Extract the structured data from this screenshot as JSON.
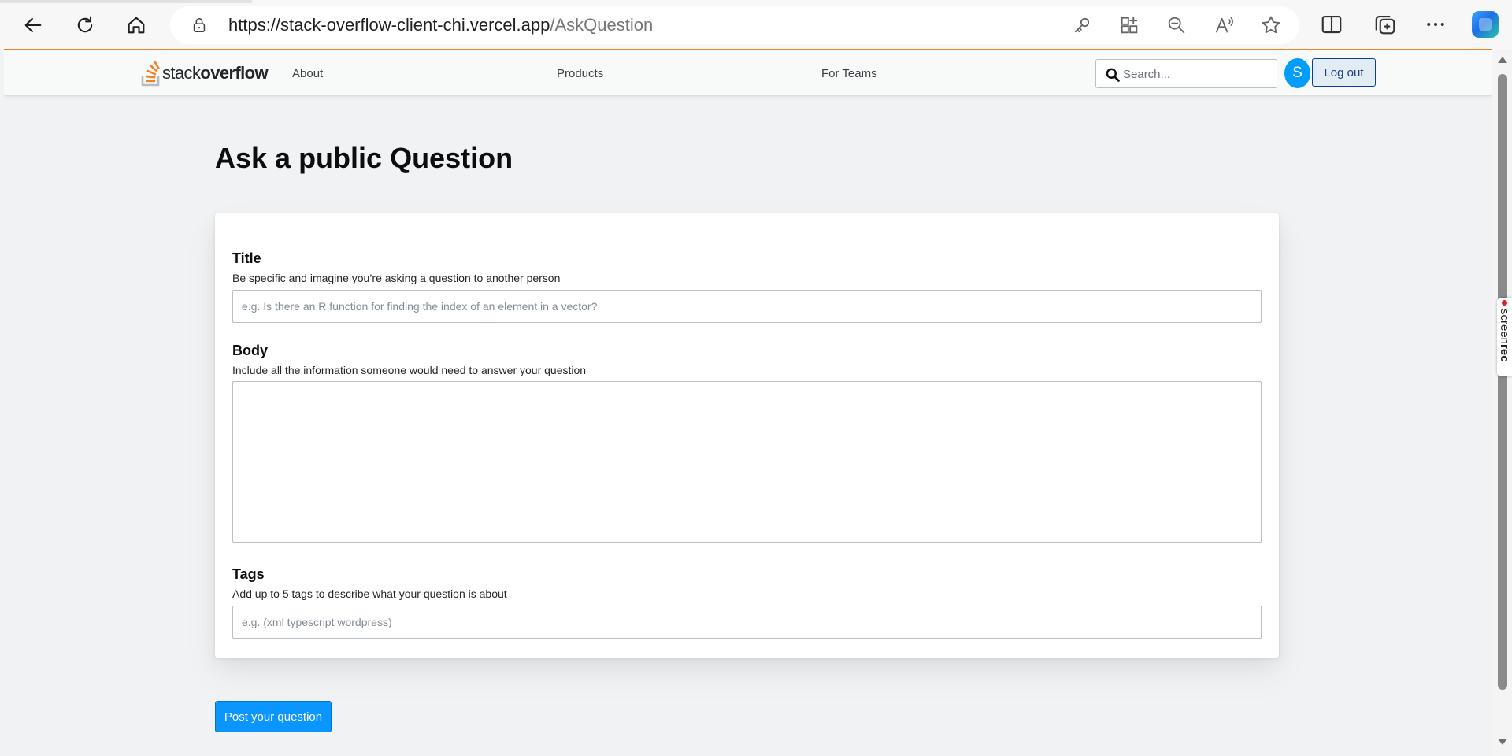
{
  "browser": {
    "url_host": "https://stack-overflow-client-chi.vercel.app",
    "url_path": "/AskQuestion",
    "icons": [
      "back-icon",
      "refresh-icon",
      "home-icon",
      "lock-icon",
      "key-icon",
      "apps-icon",
      "zoom-out-icon",
      "read-aloud-icon",
      "favorite-star-icon",
      "split-screen-icon",
      "collections-icon",
      "more-icon",
      "copilot-icon"
    ]
  },
  "header": {
    "logo_light": "stack",
    "logo_bold": "overflow",
    "nav": [
      "About",
      "Products",
      "For Teams"
    ],
    "search_placeholder": "Search...",
    "avatar_initial": "S",
    "logout_label": "Log out"
  },
  "page": {
    "title": "Ask a public Question"
  },
  "form": {
    "title_label": "Title",
    "title_desc": "Be specific and imagine you’re asking a question to another person",
    "title_placeholder": "e.g. Is there an R function for finding the index of an element in a vector?",
    "body_label": "Body",
    "body_desc": "Include all the information someone would need to answer your question",
    "tags_label": "Tags",
    "tags_desc": "Add up to 5 tags to describe what your question is about",
    "tags_placeholder": "e.g. (xml typescript wordpress)"
  },
  "post_button_label": "Post your question",
  "watermark": {
    "light": "screen",
    "bold": "rec"
  },
  "colors": {
    "accent_orange": "#f48024",
    "primary_blue": "#0a95ff",
    "avatar_blue": "#009dff"
  }
}
